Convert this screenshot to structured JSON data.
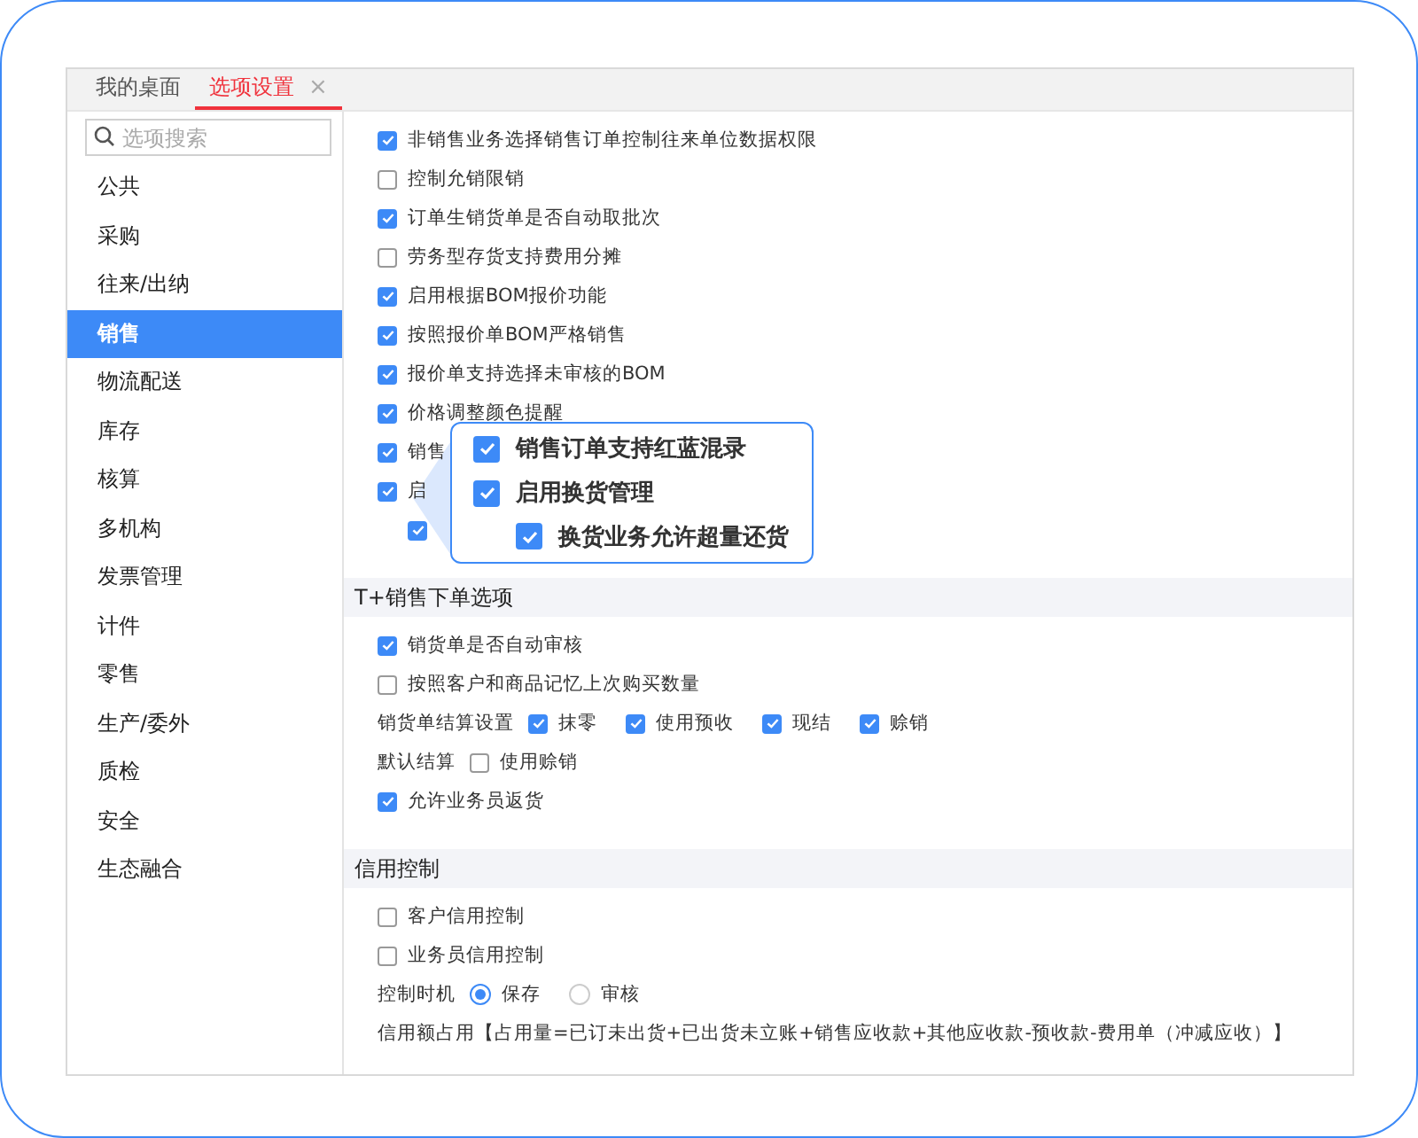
{
  "tabs": [
    {
      "label": "我的桌面",
      "selected": false
    },
    {
      "label": "选项设置",
      "selected": true,
      "close": "×"
    }
  ],
  "search": {
    "placeholder": "选项搜索"
  },
  "sidebar": {
    "items": [
      {
        "label": "公共",
        "selected": false
      },
      {
        "label": "采购",
        "selected": false
      },
      {
        "label": "往来/出纳",
        "selected": false
      },
      {
        "label": "销售",
        "selected": true
      },
      {
        "label": "物流配送",
        "selected": false
      },
      {
        "label": "库存",
        "selected": false
      },
      {
        "label": "核算",
        "selected": false
      },
      {
        "label": "多机构",
        "selected": false
      },
      {
        "label": "发票管理",
        "selected": false
      },
      {
        "label": "计件",
        "selected": false
      },
      {
        "label": "零售",
        "selected": false
      },
      {
        "label": "生产/委外",
        "selected": false
      },
      {
        "label": "质检",
        "selected": false
      },
      {
        "label": "安全",
        "selected": false
      },
      {
        "label": "生态融合",
        "selected": false
      }
    ]
  },
  "sections": [
    {
      "rows": [
        {
          "kind": "check",
          "label": "非销售业务选择销售订单控制往来单位数据权限",
          "checked": true
        },
        {
          "kind": "check",
          "label": "控制允销限销",
          "checked": false
        },
        {
          "kind": "check",
          "label": "订单生销货单是否自动取批次",
          "checked": true
        },
        {
          "kind": "check",
          "label": "劳务型存货支持费用分摊",
          "checked": false
        },
        {
          "kind": "check",
          "label": "启用根据BOM报价功能",
          "checked": true
        },
        {
          "kind": "check",
          "label": "按照报价单BOM严格销售",
          "checked": true
        },
        {
          "kind": "check",
          "label": "报价单支持选择未审核的BOM",
          "checked": true
        },
        {
          "kind": "check",
          "label": "价格调整颜色提醒",
          "checked": true
        },
        {
          "kind": "check",
          "label": "销售",
          "checked": true
        },
        {
          "kind": "check",
          "label": "启",
          "checked": true,
          "children": [
            {
              "kind": "check",
              "checked": true
            }
          ]
        }
      ]
    },
    {
      "header": "T+销售下单选项",
      "rows": [
        {
          "kind": "check",
          "label": "销货单是否自动审核",
          "checked": true
        },
        {
          "kind": "check",
          "label": "按照客户和商品记忆上次购买数量",
          "checked": false
        },
        {
          "kind": "group",
          "label": "销货单结算设置",
          "options": [
            {
              "label": "抹零",
              "checked": true
            },
            {
              "label": "使用预收",
              "checked": true
            },
            {
              "label": "现结",
              "checked": true
            },
            {
              "label": "赊销",
              "checked": true
            }
          ]
        },
        {
          "kind": "group",
          "label": "默认结算",
          "options": [
            {
              "label": "使用赊销",
              "checked": false
            }
          ]
        },
        {
          "kind": "check",
          "label": "允许业务员返货",
          "checked": true
        }
      ]
    },
    {
      "header": "信用控制",
      "rows": [
        {
          "kind": "check",
          "label": "客户信用控制",
          "checked": false
        },
        {
          "kind": "check",
          "label": "业务员信用控制",
          "checked": false
        },
        {
          "kind": "radio",
          "label": "控制时机",
          "options": [
            {
              "label": "保存",
              "selected": true
            },
            {
              "label": "审核",
              "selected": false
            }
          ]
        },
        {
          "kind": "text",
          "label": "信用额占用【占用量=已订未出货+已出货未立账+销售应收款+其他应收款-预收款-费用单（冲减应收）】"
        }
      ]
    }
  ],
  "callout": {
    "items": [
      {
        "label": "销售订单支持红蓝混录",
        "checked": true
      },
      {
        "label": "启用换货管理",
        "checked": true,
        "children": [
          {
            "label": "换货业务允许超量还货",
            "checked": true
          }
        ]
      }
    ]
  }
}
